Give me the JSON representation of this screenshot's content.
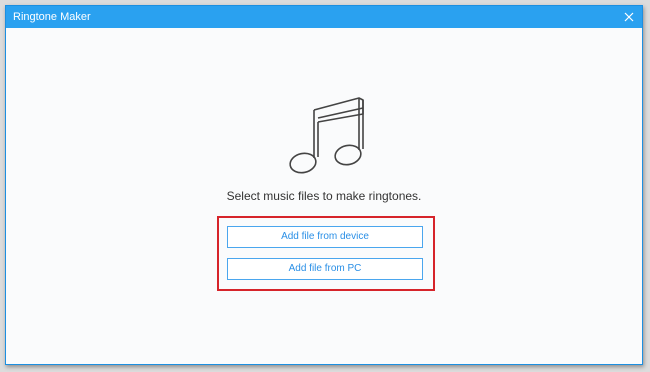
{
  "window": {
    "title": "Ringtone Maker"
  },
  "content": {
    "prompt": "Select music files to make ringtones.",
    "add_device_label": "Add file from device",
    "add_pc_label": "Add file from PC"
  },
  "icons": {
    "main": "music-note-icon",
    "close": "close-icon"
  },
  "colors": {
    "titlebar": "#2aa1f0",
    "button_text": "#2a8fe6",
    "button_border": "#4aa6ee",
    "highlight": "#d6242a"
  }
}
